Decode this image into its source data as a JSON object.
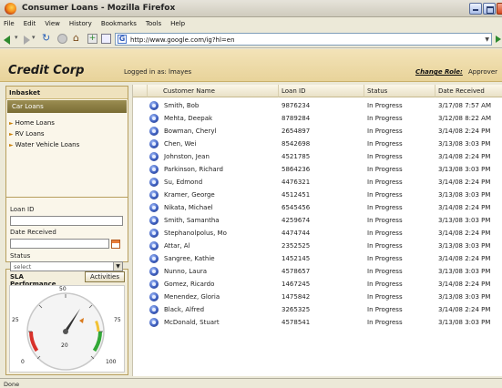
{
  "window": {
    "title": "Consumer Loans - Mozilla Firefox"
  },
  "menu": [
    "File",
    "Edit",
    "View",
    "History",
    "Bookmarks",
    "Tools",
    "Help"
  ],
  "browser": {
    "url": "http://www.google.com/ig?hl=en"
  },
  "app": {
    "title": "Credit Corp",
    "logged_in": "Logged in as: lmayes",
    "change_role": "Change Role:",
    "role": "Approver"
  },
  "inbasket": {
    "header": "Inbasket",
    "selected": "Car Loans",
    "items": [
      "Home Loans",
      "RV Loans",
      "Water Vehicle Loans"
    ]
  },
  "filters": {
    "loan_id_label": "Loan ID",
    "date_label": "Date Received",
    "status_label": "Status",
    "status_value": "select"
  },
  "sla": {
    "tab_label": "SLA Performance",
    "activities_label": "Activities",
    "gauge": {
      "min": 0,
      "max": 100,
      "ticks": [
        "0",
        "20",
        "25",
        "50",
        "75",
        "100"
      ],
      "needle_value": 62
    }
  },
  "table": {
    "headers": [
      "Customer Name",
      "Loan ID",
      "Status",
      "Date Received"
    ],
    "rows": [
      [
        "Smith, Bob",
        "9876234",
        "In Progress",
        "3/17/08 7:57 AM"
      ],
      [
        "Mehta, Deepak",
        "8789284",
        "In Progress",
        "3/12/08 8:22 AM"
      ],
      [
        "Bowman, Cheryl",
        "2654897",
        "In Progress",
        "3/14/08 2:24 PM"
      ],
      [
        "Chen, Wei",
        "8542698",
        "In Progress",
        "3/13/08 3:03 PM"
      ],
      [
        "Johnston, Jean",
        "4521785",
        "In Progress",
        "3/14/08 2:24 PM"
      ],
      [
        "Parkinson, Richard",
        "5864236",
        "In Progress",
        "3/13/08 3:03 PM"
      ],
      [
        "Su, Edmond",
        "4476321",
        "In Progress",
        "3/14/08 2:24 PM"
      ],
      [
        "Kramer, George",
        "4512451",
        "In Progress",
        "3/13/08 3:03 PM"
      ],
      [
        "Nikata, Michael",
        "6545456",
        "In Progress",
        "3/14/08 2:24 PM"
      ],
      [
        "Smith, Samantha",
        "4259674",
        "In Progress",
        "3/13/08 3:03 PM"
      ],
      [
        "Stephanolpolus, Mo",
        "4474744",
        "In Progress",
        "3/14/08 2:24 PM"
      ],
      [
        "Attar, Al",
        "2352525",
        "In Progress",
        "3/13/08 3:03 PM"
      ],
      [
        "Sangree, Kathie",
        "1452145",
        "In Progress",
        "3/14/08 2:24 PM"
      ],
      [
        "Nunno, Laura",
        "4578657",
        "In Progress",
        "3/13/08 3:03 PM"
      ],
      [
        "Gomez, Ricardo",
        "1467245",
        "In Progress",
        "3/14/08 2:24 PM"
      ],
      [
        "Menendez, Gloria",
        "1475842",
        "In Progress",
        "3/13/08 3:03 PM"
      ],
      [
        "Black, Alfred",
        "3265325",
        "In Progress",
        "3/14/08 2:24 PM"
      ],
      [
        "McDonald, Stuart",
        "4578541",
        "In Progress",
        "3/13/08 3:03 PM"
      ]
    ]
  },
  "statusbar": {
    "text": "Done"
  },
  "colors": {
    "header_bg": "#f3e3b8",
    "selected_item": "#8c7e43",
    "panel_border": "#b79f5e"
  }
}
